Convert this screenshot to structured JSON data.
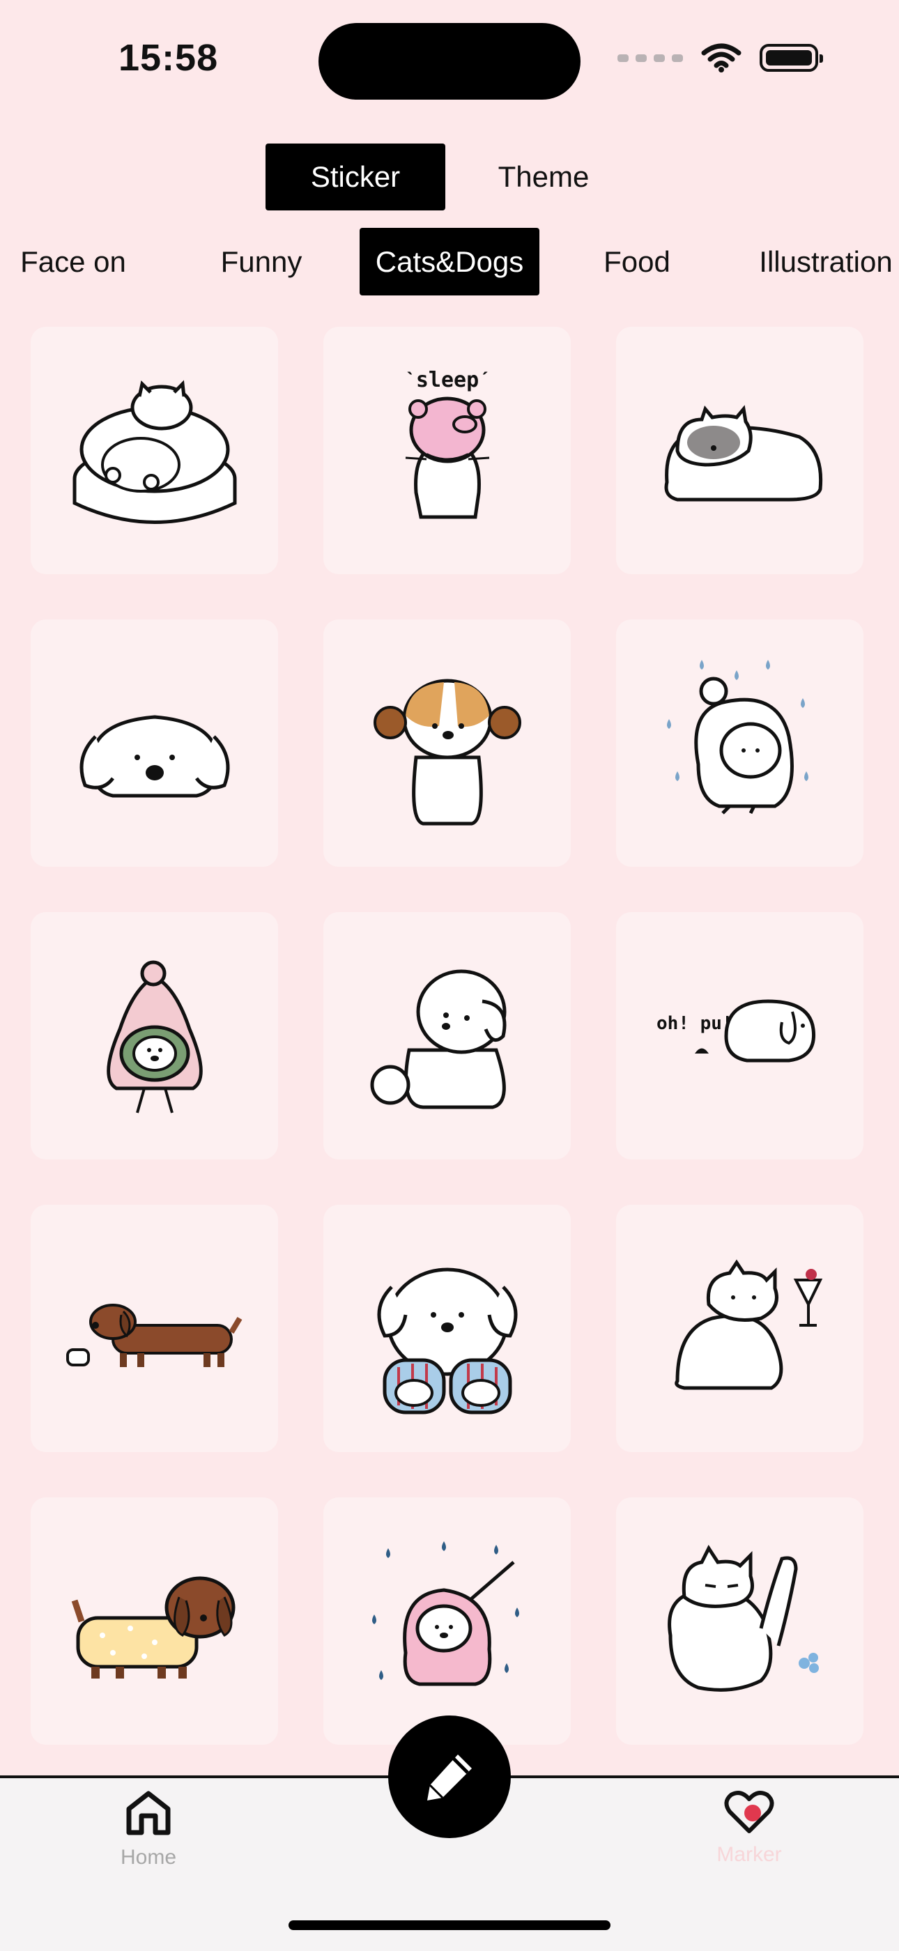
{
  "status": {
    "time": "15:58"
  },
  "top_tabs": [
    {
      "label": "Sticker",
      "active": true
    },
    {
      "label": "Theme",
      "active": false
    }
  ],
  "categories": [
    {
      "label": "Face on",
      "active": false
    },
    {
      "label": "Funny",
      "active": false
    },
    {
      "label": "Cats&Dogs",
      "active": true
    },
    {
      "label": "Food",
      "active": false
    },
    {
      "label": "Illustration",
      "active": false
    }
  ],
  "stickers": [
    {
      "icon": "cat-in-bed-icon"
    },
    {
      "icon": "sleeping-cat-pig-hat-icon",
      "text": "ˋsleepˊ"
    },
    {
      "icon": "gray-face-cat-lying-icon"
    },
    {
      "icon": "white-dog-lying-icon"
    },
    {
      "icon": "dog-with-earmuffs-icon"
    },
    {
      "icon": "dog-hooded-in-rain-icon"
    },
    {
      "icon": "dog-in-pink-hood-icon"
    },
    {
      "icon": "fluffy-white-dog-sitting-icon"
    },
    {
      "icon": "dog-oh-pu-icon",
      "text": "oh! pu!"
    },
    {
      "icon": "dachshund-with-bowl-icon"
    },
    {
      "icon": "dog-in-slippers-icon"
    },
    {
      "icon": "cat-with-cocktail-icon"
    },
    {
      "icon": "dachshund-yellow-sweater-icon"
    },
    {
      "icon": "dog-pink-raincoat-umbrella-icon"
    },
    {
      "icon": "cat-stretching-leg-icon"
    }
  ],
  "tabbar": {
    "home_label": "Home",
    "marker_label": "Marker",
    "fab_icon": "pencil-icon"
  },
  "colors": {
    "background": "#fde8ea",
    "card": "#fdf0f1",
    "active_tab": "#000000",
    "heart_dot": "#e0384e"
  }
}
